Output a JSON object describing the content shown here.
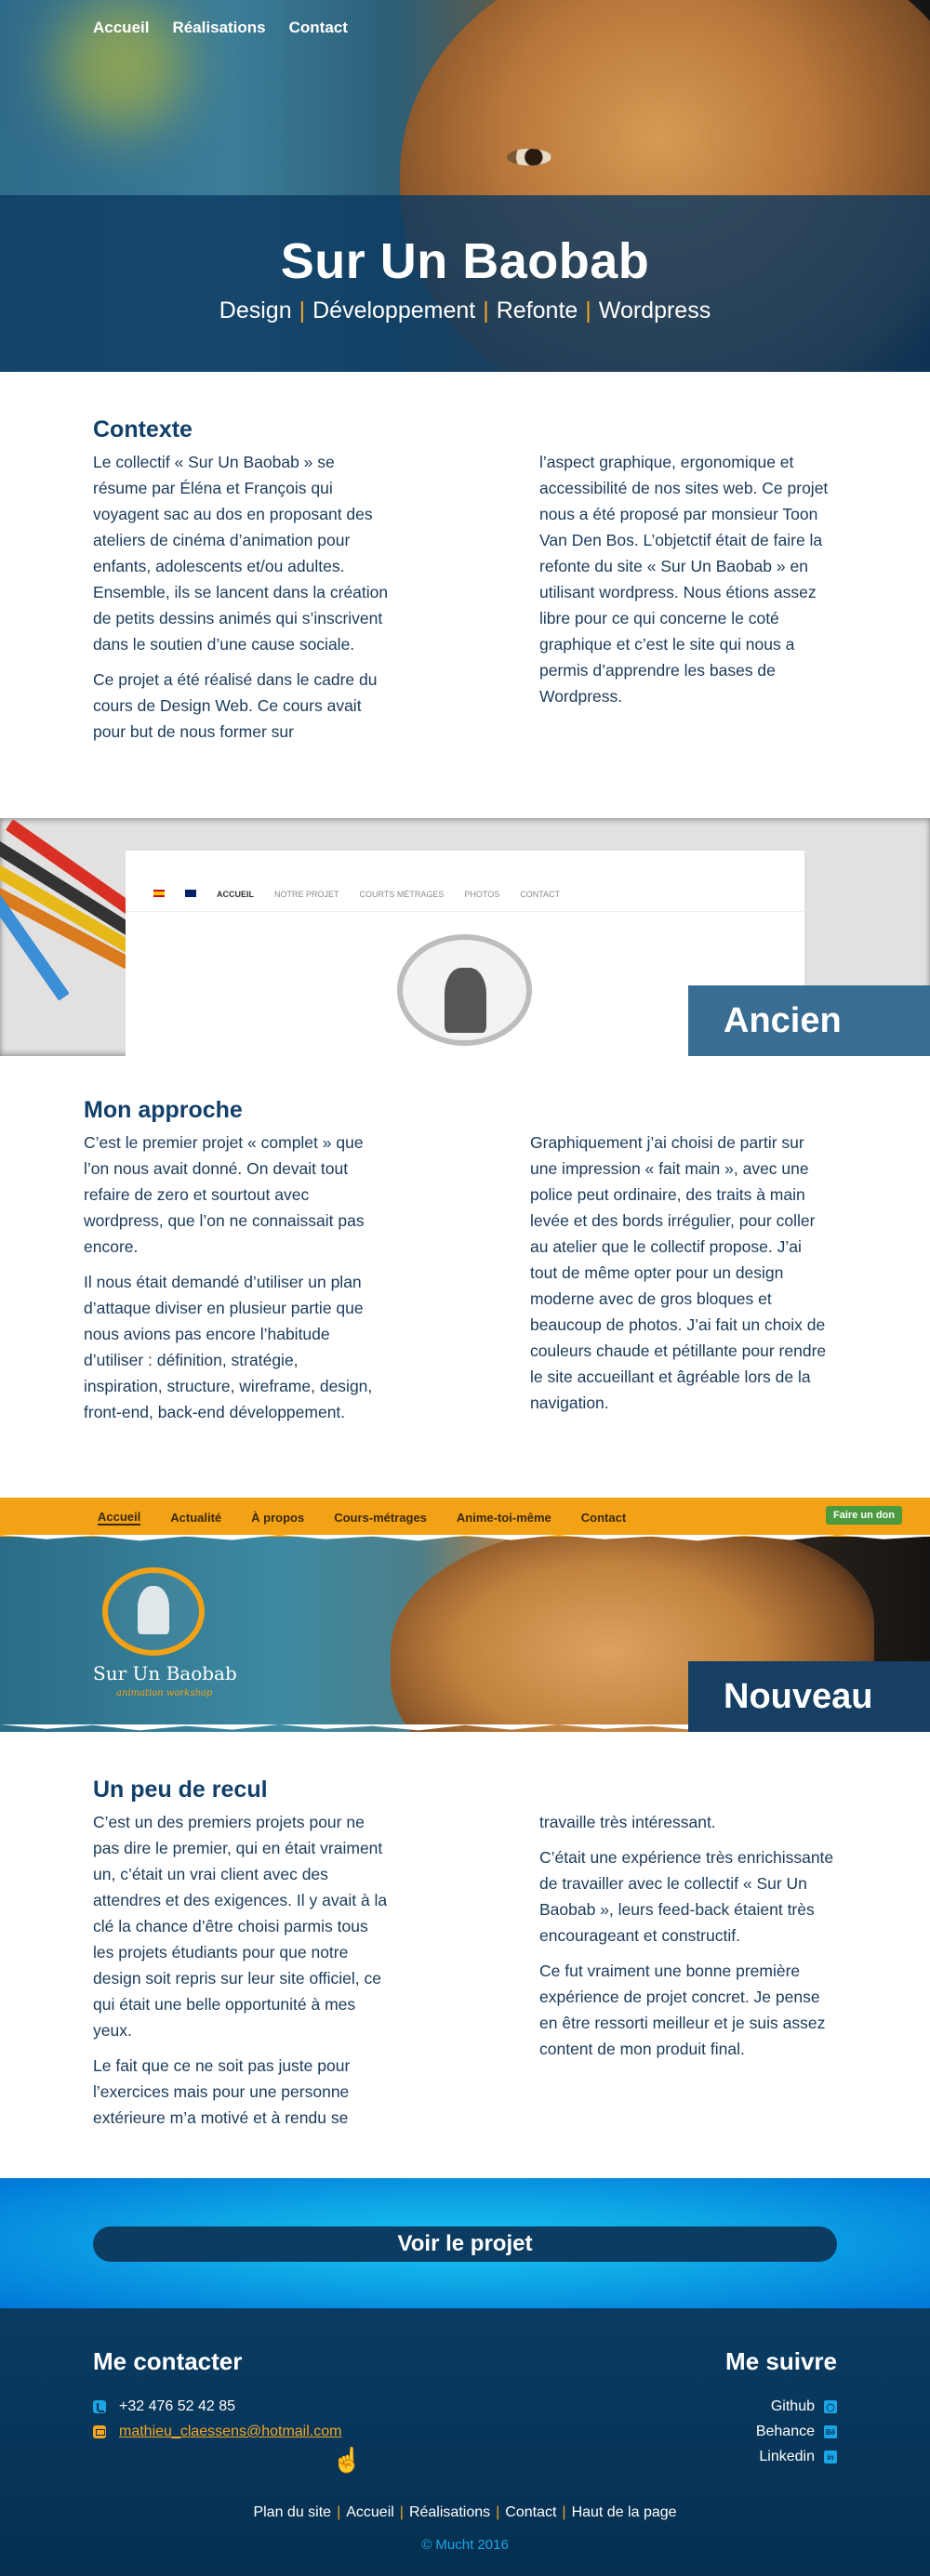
{
  "nav": {
    "items": [
      "Accueil",
      "Réalisations",
      "Contact"
    ]
  },
  "hero": {
    "title": "Sur Un Baobab",
    "tags": [
      "Design",
      "Développement",
      "Refonte",
      "Wordpress"
    ]
  },
  "contexte": {
    "title": "Contexte",
    "left": [
      "Le collectif « Sur Un Baobab » se résume par Éléna et François qui voyagent sac au dos en proposant des ateliers de cinéma d’animation pour enfants, adolescents et/ou adultes. Ensemble, ils se lancent dans la création de petits dessins animés qui s’inscrivent dans le soutien d’une cause sociale.",
      "Ce projet a été réalisé dans le cadre du cours de Design Web. Ce cours avait pour but de nous former sur"
    ],
    "right": [
      "l’aspect graphique, ergonomique et accessibilité de nos sites web. Ce projet nous a été proposé par monsieur Toon Van Den Bos. L’objetctif était de faire la refonte du site « Sur Un Baobab » en utilisant wordpress. Nous étions assez libre pour ce qui concerne le coté graphique et c’est le site qui nous a permis d’apprendre les bases de Wordpress."
    ]
  },
  "old_site": {
    "label": "Ancien site",
    "nav": [
      "ACCUEIL",
      "NOTRE PROJET",
      "COURTS MÉTRAGES",
      "PHOTOS",
      "CONTACT"
    ]
  },
  "approche": {
    "title": "Mon approche",
    "left": [
      "C’est le premier projet « complet » que l’on nous avait donné. On devait tout refaire de zero et sourtout avec wordpress, que l’on ne connaissait pas encore.",
      "Il nous était demandé d’utiliser un plan d’attaque diviser en plusieur partie que nous avions pas encore l’habitude d’utiliser : définition, stratégie, inspiration, structure, wireframe, design, front-end, back-end développement."
    ],
    "right": [
      "Graphiquement j’ai choisi de partir sur une impression « fait main », avec une police peut ordinaire, des traits à main levée et des bords irrégulier, pour coller au atelier que le collectif propose. J’ai tout de même opter pour un design moderne avec de gros bloques et beaucoup de photos. J’ai fait un choix de couleurs chaude et pétillante pour rendre le site accueillant et âgréable lors de la navigation."
    ]
  },
  "new_site": {
    "label": "Nouveau site",
    "nav": [
      "Accueil",
      "Actualité",
      "À propos",
      "Cours-métrages",
      "Anime-toi-même",
      "Contact"
    ],
    "donate": "Faire un don",
    "logo_title": "Sur Un Baobab",
    "logo_sub": "animation workshop"
  },
  "recul": {
    "title": "Un peu de recul",
    "left": [
      "C’est un des premiers projets pour ne pas dire le premier, qui en était vraiment un, c’était un vrai client avec des attendres et des exigences. Il y avait à la clé la chance d’être choisi parmis tous les projets étudiants pour que notre design soit repris sur leur site officiel, ce qui était une belle opportunité à mes yeux.",
      "Le fait que ce ne soit pas juste pour l’exercices mais pour une personne extérieure m’a motivé et à rendu se"
    ],
    "right": [
      "travaille très intéressant.",
      "C’était une expérience très enrichissante de travailler avec le collectif « Sur Un Baobab », leurs feed-back étaient très encourageant et constructif.",
      "Ce fut vraiment une bonne première expérience de projet concret. Je pense en être ressorti meilleur et je suis assez content de mon produit final."
    ]
  },
  "cta": {
    "label": "Voir le projet"
  },
  "footer": {
    "contact_title": "Me contacter",
    "phone": "+32 476 52 42 85",
    "email": "mathieu_claessens@hotmail.com",
    "follow_title": "Me suivre",
    "social": [
      {
        "label": "Github",
        "icon": "github-icon"
      },
      {
        "label": "Behance",
        "icon": "behance-icon"
      },
      {
        "label": "Linkedin",
        "icon": "linkedin-icon"
      }
    ],
    "links": [
      "Plan du site",
      "Accueil",
      "Réalisations",
      "Contact",
      "Haut de la page"
    ],
    "copyright": "© Mucht 2016"
  },
  "colors": {
    "accent": "#f5a623",
    "navy": "#0d3c62",
    "sky": "#17c3f5"
  }
}
